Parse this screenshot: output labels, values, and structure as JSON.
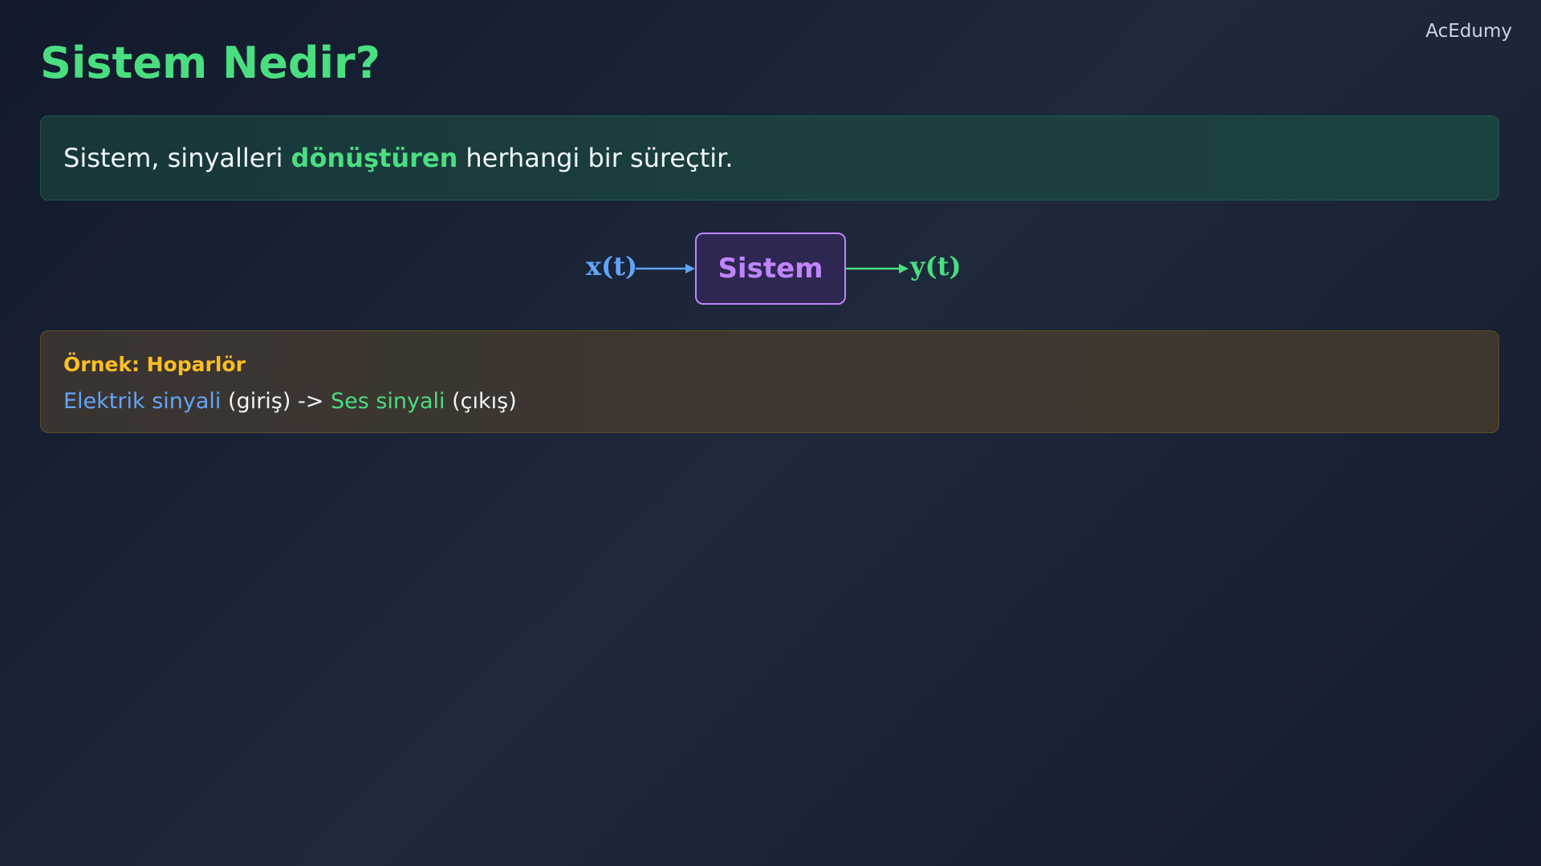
{
  "brand": "AcEdumy",
  "title": "Sistem Nedir?",
  "definition": {
    "before": "Sistem, sinyalleri",
    "highlight": "dönüştüren",
    "after": "herhangi bir süreçtir."
  },
  "diagram": {
    "input_label": "x(t)",
    "system_label": "Sistem",
    "output_label": "y(t)"
  },
  "example": {
    "title": "Örnek: Hoparlör",
    "input_text": "Elektrik sinyali",
    "input_suffix": " (giriş) -> ",
    "output_text": "Ses sinyali",
    "output_suffix": " (çıkış)"
  },
  "colors": {
    "title": "#4ade80",
    "input": "#60a5fa",
    "output": "#4ade80",
    "system": "#c084fc",
    "example_title": "#fbbf24"
  }
}
